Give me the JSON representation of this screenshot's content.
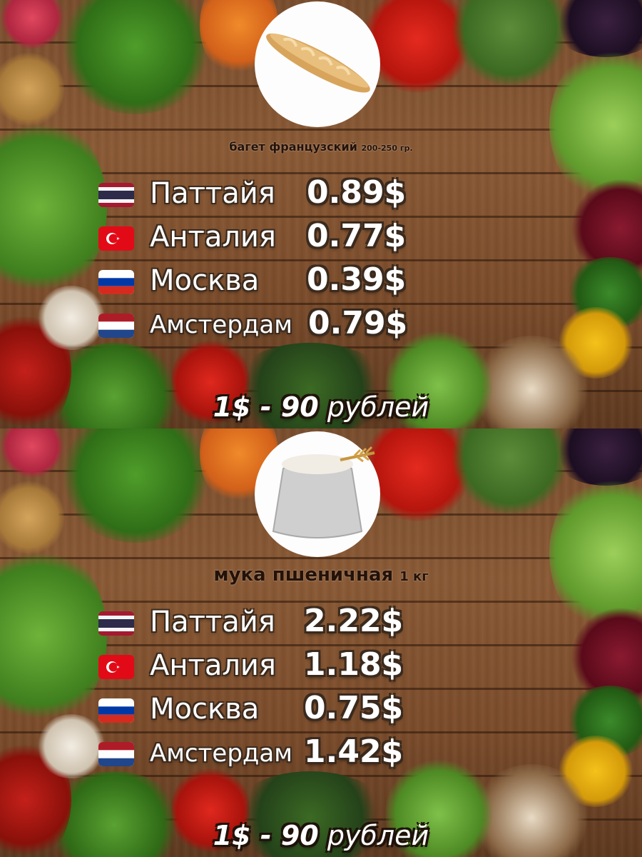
{
  "usd_rate": {
    "amount": "1$ - 90",
    "unit": "рублей"
  },
  "cities": [
    {
      "name": "Паттайя",
      "flag": "thailand-flag"
    },
    {
      "name": "Анталия",
      "flag": "turkey-flag"
    },
    {
      "name": "Москва",
      "flag": "russia-flag"
    },
    {
      "name": "Амстердам",
      "flag": "netherlands-flag"
    }
  ],
  "items": [
    {
      "name": "багет французский",
      "weight": "200-250 гр.",
      "image": "baguette-image",
      "prices": [
        "0.89$",
        "0.77$",
        "0.39$",
        "0.79$"
      ]
    },
    {
      "name": "мука пшеничная",
      "weight": "1 кг",
      "image": "flour-sack-image",
      "prices": [
        "2.22$",
        "1.18$",
        "0.75$",
        "1.42$"
      ]
    }
  ],
  "colors": {
    "text": "#ffffff",
    "outline": "#3a2a1e",
    "board": "#8b5a35"
  }
}
